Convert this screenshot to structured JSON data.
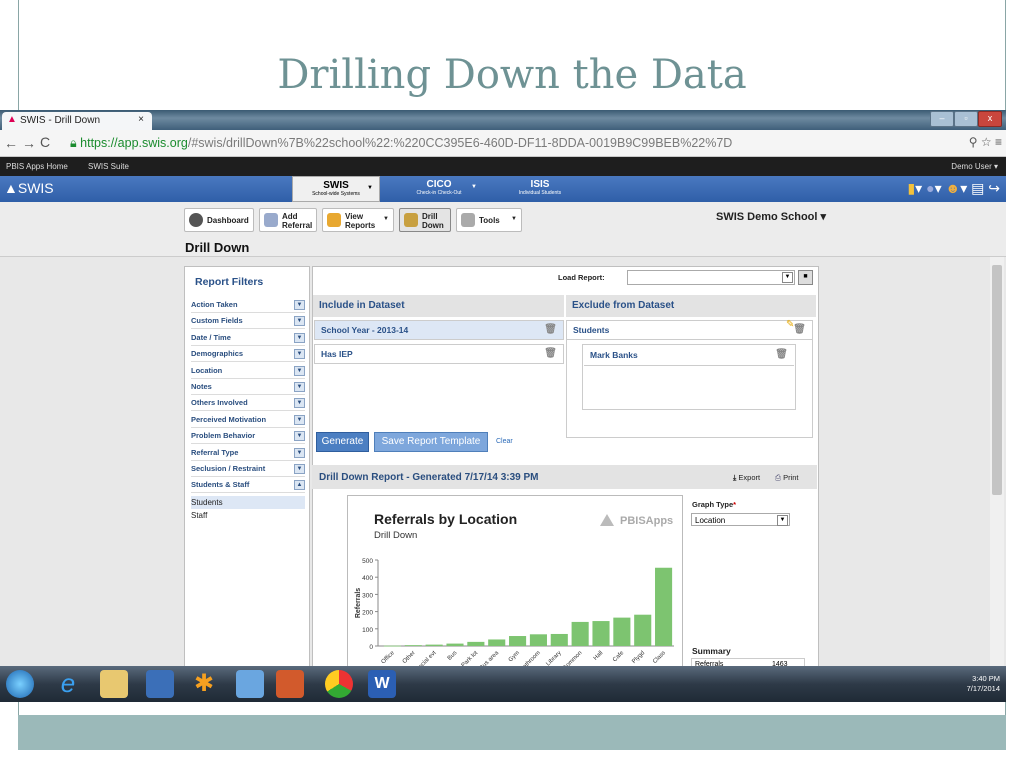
{
  "slide": {
    "title": "Drilling Down the Data"
  },
  "browser": {
    "tab_title": "SWIS - Drill Down",
    "tab_close": "×",
    "url_secure": "https://app.swis.org",
    "url_rest": "/#swis/drillDown%7B%22school%22:%220CC395E6-460D-DF11-8DDA-0019B9C99BEB%22%7D",
    "window_controls": [
      "–",
      "▫",
      "x"
    ]
  },
  "appsbar": {
    "left": [
      "PBIS Apps Home",
      "SWIS Suite"
    ],
    "user": "Demo User ▾"
  },
  "swisnav": {
    "logo": "SWIS",
    "tabs": [
      {
        "label": "SWIS",
        "sub": "School-wide Systems"
      },
      {
        "label": "CICO",
        "sub": "Check-in Check-Out"
      },
      {
        "label": "ISIS",
        "sub": "Individual Students"
      }
    ]
  },
  "toolbar": {
    "buttons": [
      "Dashboard",
      "Add Referral",
      "View Reports",
      "Drill Down",
      "Tools"
    ],
    "school": "SWIS Demo School ▾",
    "heading": "Drill Down"
  },
  "filters": {
    "title": "Report Filters",
    "items": [
      "Action Taken",
      "Custom Fields",
      "Date / Time",
      "Demographics",
      "Location",
      "Notes",
      "Others Involved",
      "Perceived Motivation",
      "Problem Behavior",
      "Referral Type",
      "Seclusion / Restraint",
      "Students & Staff"
    ],
    "sub_items": [
      "Students",
      "Staff"
    ]
  },
  "dataset": {
    "load_label": "Load Report:",
    "include_title": "Include in Dataset",
    "exclude_title": "Exclude from Dataset",
    "include_items": [
      "School Year - 2013-14",
      "Has IEP"
    ],
    "exclude_group": "Students",
    "exclude_items": [
      "Mark Banks"
    ],
    "generate": "Generate",
    "save_template": "Save Report Template",
    "clear": "Clear"
  },
  "report": {
    "title": "Drill Down Report - Generated 7/17/14 3:39 PM",
    "export": "Export",
    "print": "Print",
    "graph_type_label": "Graph Type",
    "graph_type_value": "Location",
    "summary_title": "Summary",
    "summary_label": "Referrals",
    "summary_value": "1463"
  },
  "chart_data": {
    "type": "bar",
    "title": "Referrals by Location",
    "subtitle": "Drill Down",
    "brand": "PBISApps",
    "ylabel": "Referrals",
    "xlabel": "",
    "ylim": [
      0,
      500
    ],
    "yticks": [
      0,
      100,
      200,
      300,
      400,
      500
    ],
    "categories": [
      "Office",
      "Other",
      "Special evt",
      "Bus",
      "Park lot",
      "Bus area",
      "Gym",
      "Bathroom",
      "Library",
      "Common",
      "Hall",
      "Cafe",
      "Plygd",
      "Class"
    ],
    "values": [
      2,
      5,
      8,
      14,
      24,
      38,
      58,
      68,
      70,
      140,
      145,
      165,
      182,
      455
    ],
    "bar_color": "#7dc470",
    "grid": false
  },
  "taskbar": {
    "time": "3:40 PM",
    "date": "7/17/2014"
  }
}
